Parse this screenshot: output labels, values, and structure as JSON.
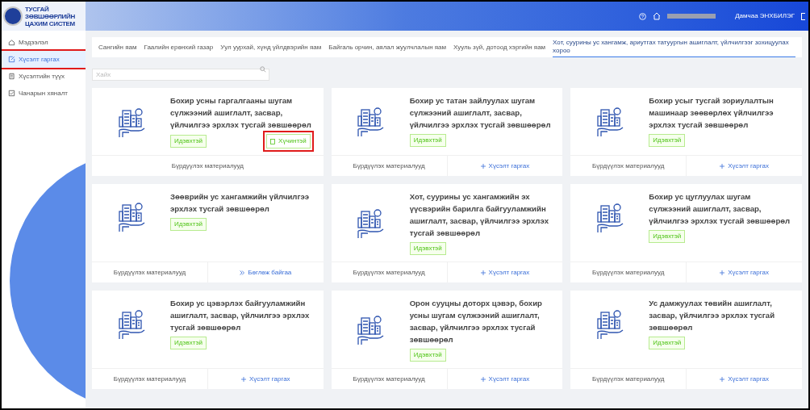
{
  "logo": {
    "lines": [
      "ТУСГАЙ",
      "ЗӨВШӨӨРЛИЙН",
      "ЦАХИМ СИСТЕМ"
    ]
  },
  "header": {
    "user": "Дамчаа ЭНХБИЛЭГ"
  },
  "sidebar": {
    "items": [
      {
        "label": "Мэдээлэл",
        "selected": false,
        "highlighted": false
      },
      {
        "label": "Хүсэлт гаргах",
        "selected": true,
        "highlighted": true
      },
      {
        "label": "Хүсэлтийн түүх",
        "selected": false,
        "highlighted": false
      },
      {
        "label": "Чанарын хяналт",
        "selected": false,
        "highlighted": false
      }
    ]
  },
  "tabs": [
    {
      "label": "Сангийн яам",
      "selected": false
    },
    {
      "label": "Гаалийн ерөнхий газар",
      "selected": false
    },
    {
      "label": "Уул уурхай, хүнд үйлдвэрийн яам",
      "selected": false
    },
    {
      "label": "Байгаль орчин, аялал жуулчлалын яам",
      "selected": false
    },
    {
      "label": "Хууль зүй, дотоод хэргийн яам",
      "selected": false
    },
    {
      "label": "Хот, суурины ус хангамж, ариутгах татуургын ашиглалт, үйлчилгээг зохицуулах хороо",
      "selected": true
    }
  ],
  "search": {
    "placeholder": "Хайх"
  },
  "cards": [
    {
      "title": "Бохир усны гаргалгааны шугам сүлжээний ашиглалт, засвар, үйлчилгээ эрхлэх тусгай зөвшөөрөл",
      "status": "Идэвхтэй",
      "button": {
        "label": "Хүчинтэй",
        "highlighted": true
      },
      "materials": "Бүрдүүлэх материалууд"
    },
    {
      "title": "Бохир ус татан зайлуулах шугам сүлжээний ашиглалт, засвар, үйлчилгээ эрхлэх тусгай зөвшөөрөл",
      "status": "Идэвхтэй",
      "materials": "Бүрдүүлэх материалууд",
      "action": {
        "kind": "request",
        "label": "Хүсэлт гаргах"
      }
    },
    {
      "title": "Бохир усыг тусгай зориулалтын машинаар зөөвөрлөх үйлчилгээ эрхлэх тусгай зөвшөөрөл",
      "status": "Идэвхтэй",
      "materials": "Бүрдүүлэх материалууд",
      "action": {
        "kind": "request",
        "label": "Хүсэлт гаргах"
      }
    },
    {
      "title": "Зөөврийн ус хангамжийн үйлчилгээ эрхлэх тусгай зөвшөөрөл",
      "status": "Идэвхтэй",
      "materials": "Бүрдүүлэх материалууд",
      "action": {
        "kind": "filling",
        "label": "Бөглөж байгаа"
      }
    },
    {
      "title": "Хот, суурины ус хангамжийн эх үүсвэрийн барилга байгууламжийн ашиглалт, засвар, үйлчилгээ эрхлэх тусгай зөвшөөрөл",
      "status": "Идэвхтэй",
      "materials": "Бүрдүүлэх материалууд",
      "action": {
        "kind": "request",
        "label": "Хүсэлт гаргах"
      }
    },
    {
      "title": "Бохир ус цуглуулах шугам сүлжээний ашиглалт, засвар, үйлчилгээ эрхлэх тусгай зөвшөөрөл",
      "status": "Идэвхтэй",
      "materials": "Бүрдүүлэх материалууд",
      "action": {
        "kind": "request",
        "label": "Хүсэлт гаргах"
      }
    },
    {
      "title": "Бохир ус цэвэрлэх байгууламжийн ашиглалт, засвар, үйлчилгээ эрхлэх тусгай зөвшөөрөл",
      "status": "Идэвхтэй",
      "materials": "Бүрдүүлэх материалууд",
      "action": {
        "kind": "request",
        "label": "Хүсэлт гаргах"
      }
    },
    {
      "title": "Орон сууцны доторх цэвэр, бохир усны шугам сүлжээний ашиглалт, засвар, үйлчилгээ эрхлэх тусгай зөвшөөрөл",
      "status": "Идэвхтэй",
      "materials": "Бүрдүүлэх материалууд",
      "action": {
        "kind": "request",
        "label": "Хүсэлт гаргах"
      }
    },
    {
      "title": "Ус дамжуулах төвийн ашиглалт, засвар, үйлчилгээ эрхлэх тусгай зөвшөөрөл",
      "status": "Идэвхтэй",
      "materials": "Бүрдүүлэх материалууд",
      "action": {
        "kind": "request",
        "label": "Хүсэлт гаргах"
      }
    }
  ]
}
